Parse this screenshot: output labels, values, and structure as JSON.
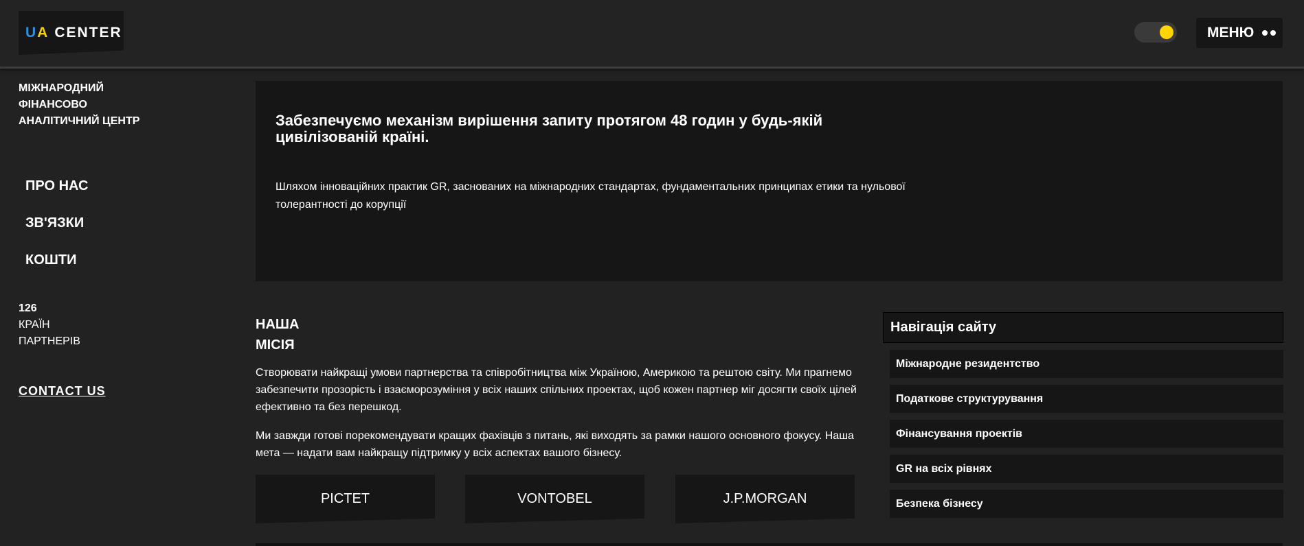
{
  "header": {
    "logo": {
      "part1": "U",
      "part2": "A",
      "part3": "CENTER"
    },
    "theme_toggle_knob_color": "#ffd600",
    "menu_label": "МЕНЮ"
  },
  "sidebar": {
    "tagline": [
      "МІЖНАРОДНИЙ",
      "ФІНАНСОВО",
      "АНАЛІТИЧНИЙ ЦЕНТР"
    ],
    "nav": [
      "ПРО НАС",
      "ЗВ'ЯЗКИ",
      "КОШТИ"
    ],
    "stats": {
      "number": "126",
      "line1": "КРАЇН",
      "line2": "ПАРТНЕРІВ"
    },
    "contact": "CONTACT US"
  },
  "hero": {
    "title": "Забезпечуємо механізм вирішення запиту протягом 48 годин у будь-якій цивілізованій країні.",
    "text": "Шляхом інноваційних практик GR, заснованих на міжнародних стандартах, фундаментальних принципах етики та нульової толерантності до корупції"
  },
  "mission": {
    "title_line1": "НАША",
    "title_line2": "МІСІЯ",
    "p1": "Створювати найкращі умови партнерства та співробітництва між Україною, Америкою та рештою світу. Ми прагнемо забезпечити прозорість і взаєморозуміння у всіх наших спільних проектах, щоб кожен партнер міг досягти своїх цілей ефективно та без перешкод.",
    "p2": "Ми завжди готові порекомендувати кращих фахівців з питань, які виходять за рамки нашого основного фокусу. Наша мета — надати вам найкращу підтримку у всіх аспектах вашого бізнесу.",
    "partners": [
      "PICTET",
      "VONTOBEL",
      "J.P.MORGAN"
    ]
  },
  "site_nav": {
    "title": "Навігація сайту",
    "items": [
      "Міжнародне резидентство",
      "Податкове структурування",
      "Фінансування проектів",
      "GR на всіх рівнях",
      "Безпека бізнесу"
    ]
  },
  "colors": {
    "background": "#222222",
    "panel": "#161616",
    "logo_blue": "#2f8fe0",
    "logo_yellow": "#f2d00d"
  }
}
